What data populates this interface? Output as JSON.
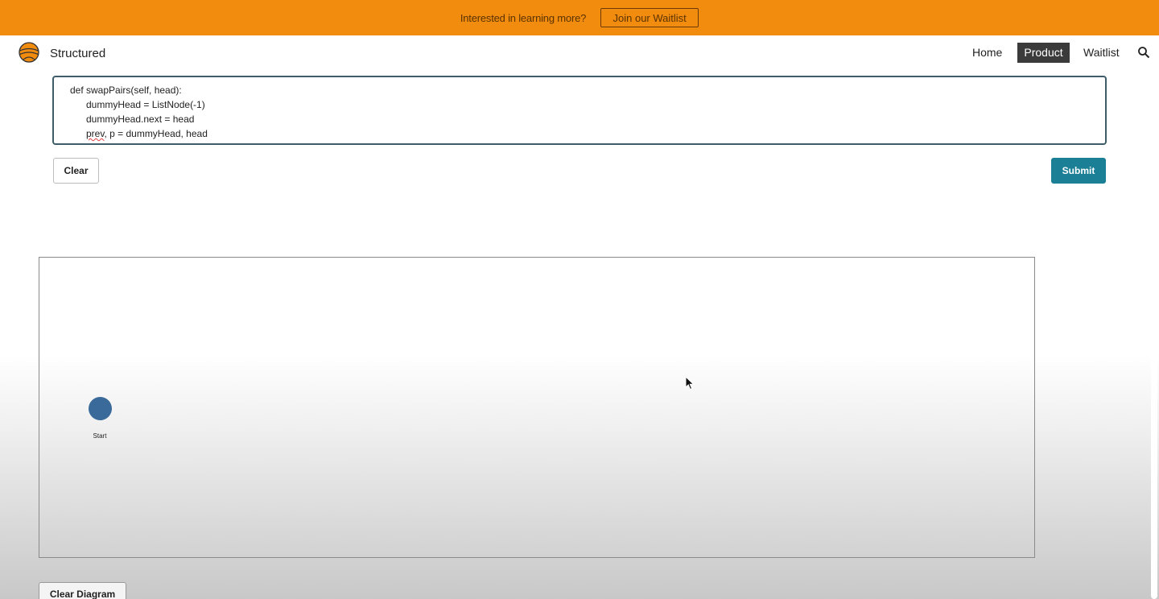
{
  "banner": {
    "text": "Interested in learning more?",
    "button_label": "Join our Waitlist",
    "color": "#f28c0f"
  },
  "header": {
    "brand": "Structured",
    "logo_icon": "basketball-icon",
    "nav": [
      {
        "label": "Home",
        "active": false
      },
      {
        "label": "Product",
        "active": true
      },
      {
        "label": "Waitlist",
        "active": false
      }
    ],
    "search_icon": "search-icon"
  },
  "editor": {
    "lines": [
      "def swapPairs(self, head):",
      "dummyHead = ListNode(-1)",
      "dummyHead.next = head",
      "prev",
      ", p = dummyHead, head"
    ],
    "clear_label": "Clear",
    "submit_label": "Submit",
    "submit_color": "#1b7f96"
  },
  "diagram": {
    "node_label": "Start",
    "node_color": "#3a6a99",
    "clear_label": "Clear Diagram"
  }
}
